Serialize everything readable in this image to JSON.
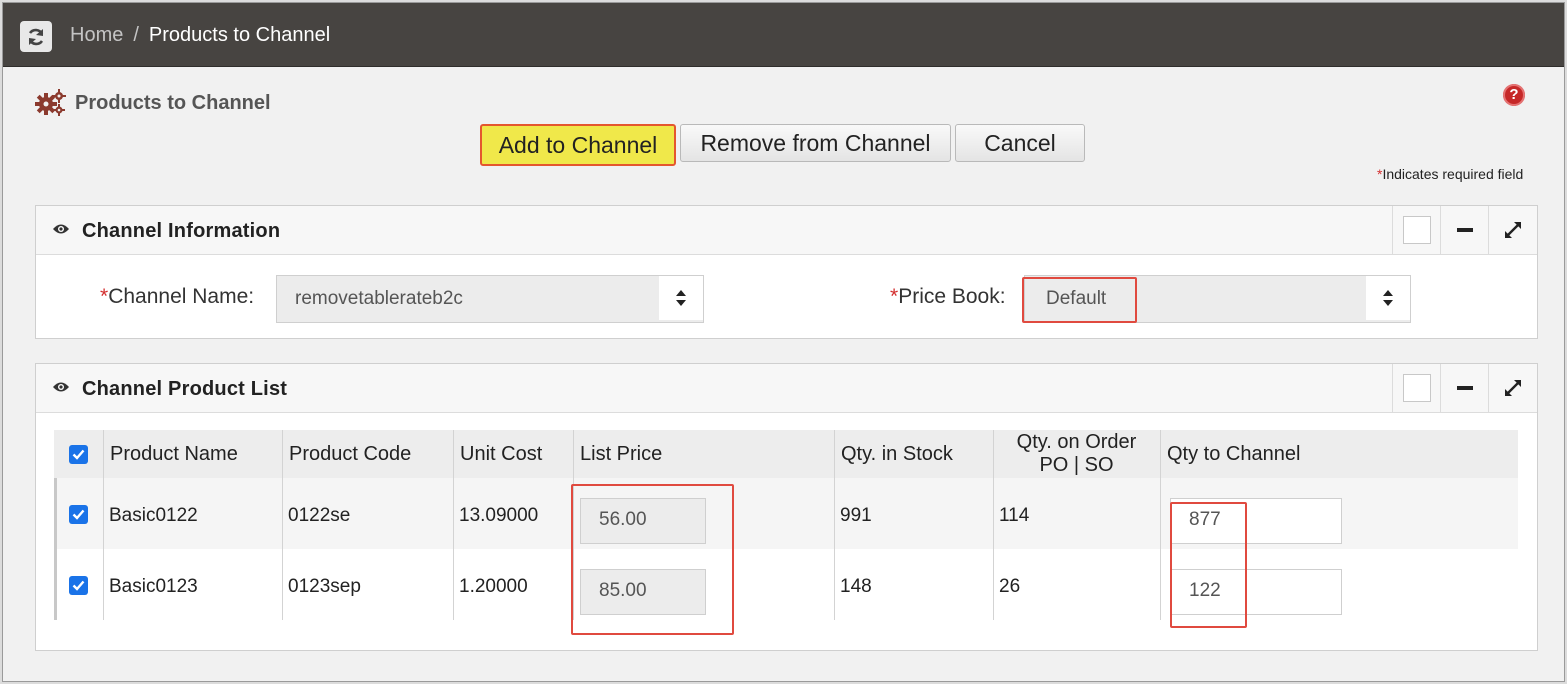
{
  "breadcrumb": {
    "home": "Home",
    "separator": "/",
    "current": "Products to Channel"
  },
  "page": {
    "title": "Products to Channel",
    "required_note": "Indicates required field",
    "required_star": "*"
  },
  "toolbar": {
    "add_label": "Add to Channel",
    "remove_label": "Remove from Channel",
    "cancel_label": "Cancel"
  },
  "channel_info": {
    "title": "Channel Information",
    "channel_name_label": "Channel Name:",
    "channel_name_value": "removetablerateb2c",
    "price_book_label": "Price Book:",
    "price_book_value": "Default"
  },
  "product_list": {
    "title": "Channel Product List",
    "columns": {
      "product_name": "Product Name",
      "product_code": "Product Code",
      "unit_cost": "Unit Cost",
      "list_price": "List Price",
      "qty_in_stock": "Qty. in Stock",
      "qty_on_order_line1": "Qty. on Order",
      "qty_on_order_line2": "PO | SO",
      "qty_to_channel": "Qty to Channel"
    },
    "rows": [
      {
        "checked": true,
        "product_name": "Basic0122",
        "product_code": "0122se",
        "unit_cost": "13.09000",
        "list_price": "56.00",
        "qty_in_stock": "991",
        "qty_on_order": "114",
        "qty_to_channel": "877"
      },
      {
        "checked": true,
        "product_name": "Basic0123",
        "product_code": "0123sep",
        "unit_cost": "1.20000",
        "list_price": "85.00",
        "qty_in_stock": "148",
        "qty_on_order": "26",
        "qty_to_channel": "122"
      }
    ]
  },
  "colors": {
    "topbar": "#474441",
    "accent_highlight": "#f0e84a",
    "annotation_red": "#e04a3f",
    "checkbox_blue": "#1a73e8",
    "help_red": "#c62828"
  }
}
